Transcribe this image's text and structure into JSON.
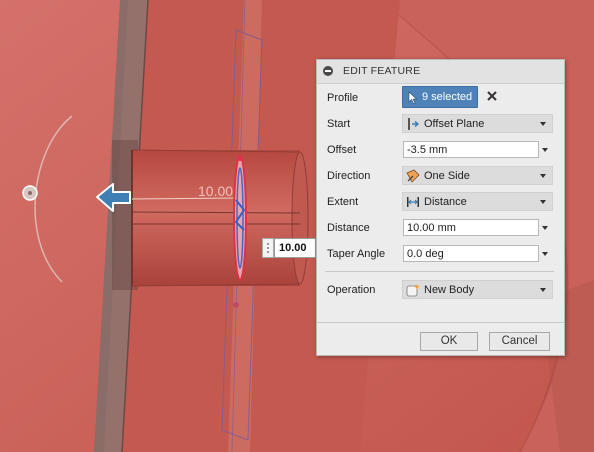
{
  "viewport": {
    "dimension_ghost_label": "10.00",
    "dimension_input_value": "10.00",
    "colors": {
      "body": "#c45a4f",
      "background": "#cf6b62",
      "highlight": "#e8a3ab",
      "arrow": "#3f7fb3"
    }
  },
  "dialog": {
    "title": "EDIT FEATURE",
    "profile": {
      "label": "Profile",
      "selected_text": "9 selected"
    },
    "start": {
      "label": "Start",
      "value": "Offset Plane",
      "icon": "offset-plane-icon"
    },
    "offset": {
      "label": "Offset",
      "value": "-3.5 mm"
    },
    "direction": {
      "label": "Direction",
      "value": "One Side",
      "icon": "one-side-icon"
    },
    "extent": {
      "label": "Extent",
      "value": "Distance",
      "icon": "distance-icon"
    },
    "distance": {
      "label": "Distance",
      "value": "10.00 mm"
    },
    "taper": {
      "label": "Taper Angle",
      "value": "0.0 deg"
    },
    "operation": {
      "label": "Operation",
      "value": "New Body",
      "icon": "new-body-icon"
    },
    "ok_label": "OK",
    "cancel_label": "Cancel",
    "accent": "#4e82b9"
  }
}
